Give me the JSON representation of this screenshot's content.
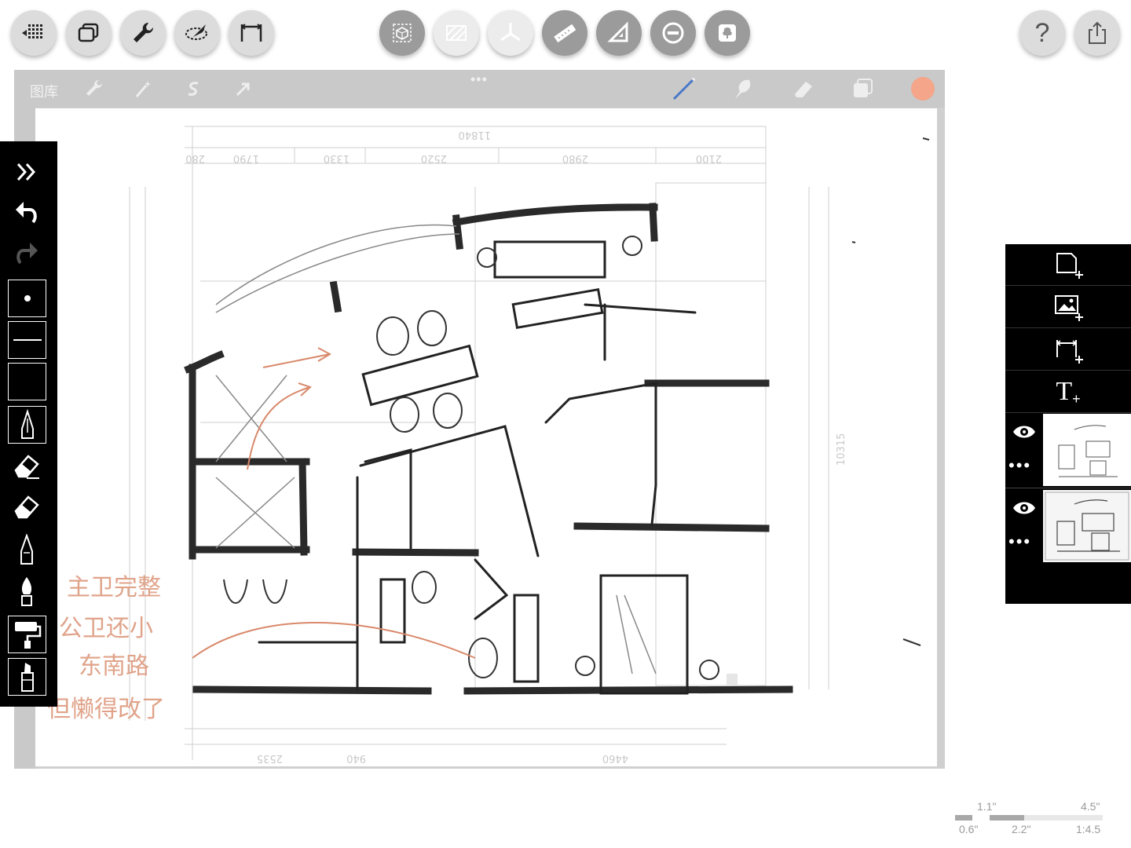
{
  "top_toolbar": {
    "left_buttons": [
      {
        "icon": "grid-menu-icon"
      },
      {
        "icon": "layers-window-icon"
      },
      {
        "icon": "wrench-icon"
      },
      {
        "icon": "lasso-select-icon"
      },
      {
        "icon": "crop-icon"
      }
    ],
    "center_buttons": [
      {
        "icon": "transform-icon"
      },
      {
        "icon": "hatch-fill-icon"
      },
      {
        "icon": "symmetry-icon"
      },
      {
        "icon": "ruler-icon"
      },
      {
        "icon": "set-square-icon"
      },
      {
        "icon": "french-curve-icon"
      },
      {
        "icon": "stencil-icon"
      }
    ],
    "right_buttons": [
      {
        "icon": "help-icon",
        "label": "?"
      },
      {
        "icon": "share-icon"
      }
    ]
  },
  "gallery_window": {
    "title": "图库",
    "handle": "•••",
    "accent_color": "#f4a58a"
  },
  "left_toolbar": {
    "items": [
      {
        "icon": "collapse-icon"
      },
      {
        "icon": "undo-icon"
      },
      {
        "icon": "redo-icon"
      },
      {
        "icon": "brush-size-icon"
      },
      {
        "icon": "opacity-icon"
      },
      {
        "icon": "color-swatch-icon"
      },
      {
        "icon": "pencil-icon"
      },
      {
        "icon": "eraser-icon"
      },
      {
        "icon": "soft-eraser-icon"
      },
      {
        "icon": "pen-icon"
      },
      {
        "icon": "ink-brush-icon"
      },
      {
        "icon": "paint-roller-icon"
      },
      {
        "icon": "marker-icon"
      }
    ]
  },
  "right_panel": {
    "add_buttons": [
      {
        "icon": "new-layer-icon"
      },
      {
        "icon": "add-image-icon"
      },
      {
        "icon": "add-dimension-icon"
      },
      {
        "icon": "add-text-icon",
        "label": "T"
      }
    ],
    "layers": [
      {
        "icon": "eye-icon",
        "more": "•••"
      },
      {
        "icon": "eye-icon",
        "more": "•••"
      }
    ]
  },
  "scale_indicator": {
    "labels_top": [
      "1.1\"",
      "4.5\""
    ],
    "labels_bottom": [
      "0.6\"",
      "2.2\"",
      "1:4.5"
    ]
  },
  "sketch_annotations": [
    "主卫完整",
    "公卫还小",
    "东南路",
    "但懒得改了"
  ]
}
